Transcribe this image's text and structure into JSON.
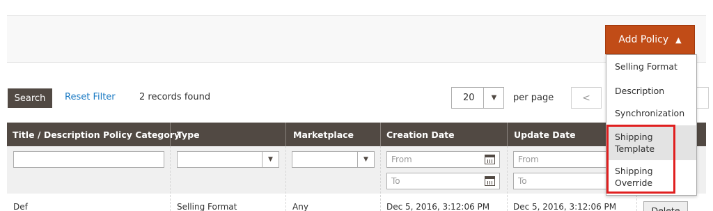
{
  "toolbar": {
    "add_policy_label": "Add Policy",
    "add_policy_caret": "▲"
  },
  "dropdown": {
    "items": [
      "Selling Format",
      "Description",
      "Synchronization",
      "Shipping\nTemplate",
      "Shipping\nOverride"
    ],
    "highlighted_index": 3
  },
  "grid_actions": {
    "search_label": "Search",
    "reset_filter_label": "Reset Filter",
    "records_found": "2 records found",
    "per_page_value": "20",
    "per_page_label": "per page",
    "prev_symbol": "<"
  },
  "table": {
    "columns": [
      "Title / Description Policy Category",
      "Type",
      "Marketplace",
      "Creation Date",
      "Update Date"
    ],
    "filters": {
      "from_placeholder": "From",
      "to_placeholder": "To"
    },
    "rows": [
      {
        "title": "Def",
        "type": "Selling Format",
        "marketplace": "Any",
        "created": "Dec 5, 2016, 3:12:06 PM",
        "updated": "Dec 5, 2016, 3:12:06 PM",
        "action": "Delete"
      }
    ]
  },
  "colors": {
    "accent": "#c14c17",
    "header_bg": "#514943",
    "link": "#1979c3",
    "callout": "#e01f1f"
  }
}
